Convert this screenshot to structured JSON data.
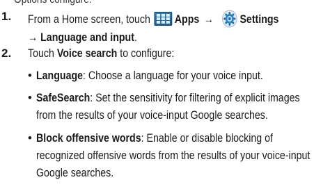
{
  "intro_cut": "Options configure:",
  "step1": {
    "num": "1.",
    "line1_prefix": "From a Home screen, touch",
    "apps_label": "Apps",
    "arrow1": "→",
    "settings_label": "Settings",
    "arrow2": "→",
    "line2_label": "Language and input",
    "line2_suffix": ".",
    "apps_icon": "apps-grid-icon",
    "settings_icon": "settings-gear-icon"
  },
  "step2": {
    "num": "2.",
    "prefix": "Touch ",
    "bold": "Voice search",
    "suffix": " to configure:"
  },
  "bullets": [
    {
      "term": "Language",
      "lines": [
        ": Choose a language for your voice input."
      ]
    },
    {
      "term": "SafeSearch",
      "lines": [
        ": Set the sensitivity for filtering of explicit images",
        "from the results of your voice-input Google searches."
      ]
    },
    {
      "term": "Block offensive words",
      "lines": [
        ": Enable or disable blocking of",
        "recognized offensive words from the results of your voice-input",
        "Google searches."
      ]
    }
  ],
  "colors": {
    "apps_icon_blue": "#2f7fb8",
    "settings_icon_blue": "#1e6fb0"
  }
}
